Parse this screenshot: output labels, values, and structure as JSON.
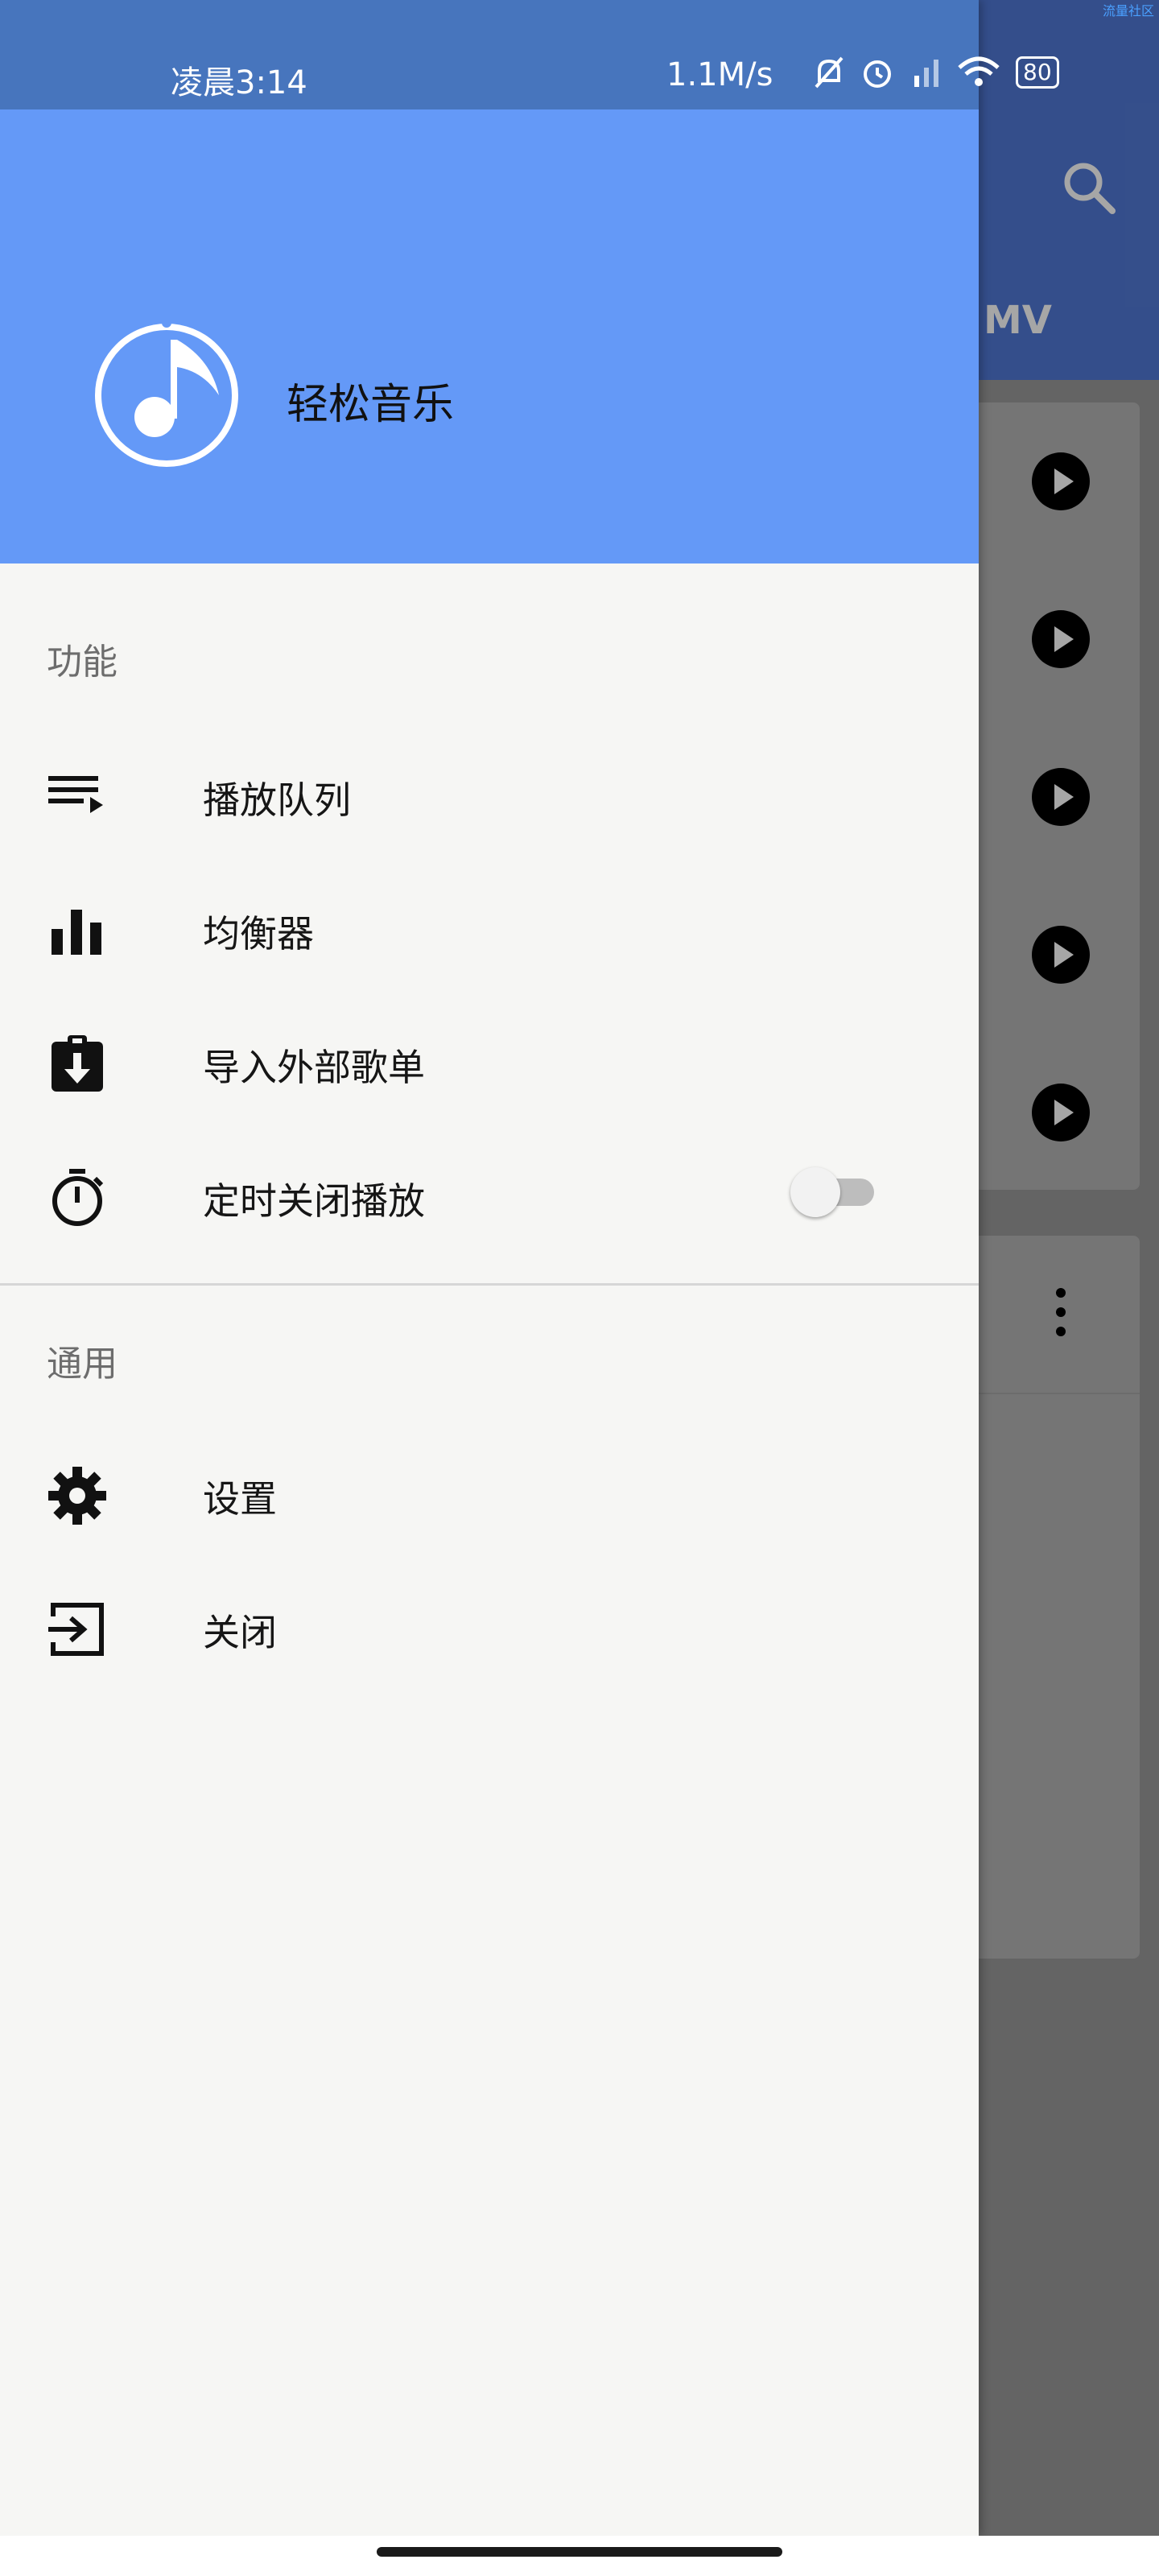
{
  "status_bar": {
    "time": "凌晨3:14",
    "network_speed": "1.1M/s",
    "battery": "80",
    "watermark": "流量社区"
  },
  "background": {
    "tab_label": "MV"
  },
  "drawer": {
    "app_name": "轻松音乐",
    "section_features": "功能",
    "items": [
      {
        "label": "播放队列",
        "icon": "queue-music-icon"
      },
      {
        "label": "均衡器",
        "icon": "equalizer-icon"
      },
      {
        "label": "导入外部歌单",
        "icon": "import-playlist-icon"
      },
      {
        "label": "定时关闭播放",
        "icon": "timer-icon",
        "toggle_on": false
      }
    ],
    "section_general": "通用",
    "general_items": [
      {
        "label": "设置",
        "icon": "gear-icon"
      },
      {
        "label": "关闭",
        "icon": "exit-icon"
      }
    ]
  },
  "colors": {
    "drawer_header": "#6499f7",
    "status_bar": "#4775bd",
    "drawer_bg": "#f6f6f4"
  }
}
